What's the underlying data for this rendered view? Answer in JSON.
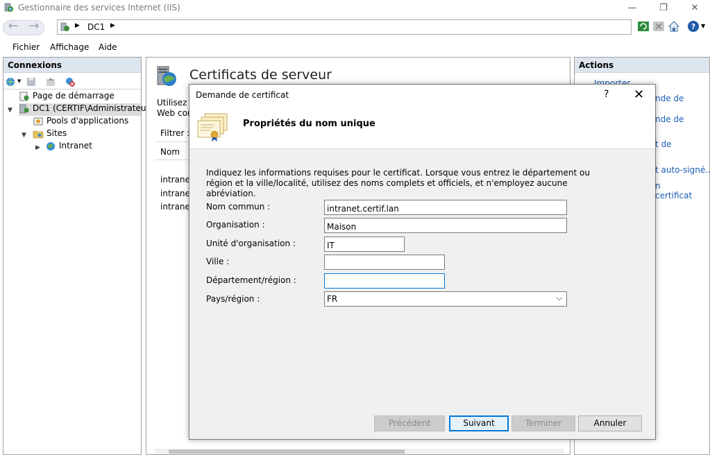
{
  "window": {
    "title": "Gestionnaire des services Internet (IIS)",
    "minimize_glyph": "—",
    "restore_glyph": "❐",
    "close_glyph": "✕"
  },
  "address": {
    "crumb": "DC1",
    "back_glyph": "←",
    "forward_glyph": "→"
  },
  "menu": {
    "file": "Fichier",
    "view": "Affichage",
    "help": "Aide"
  },
  "connections": {
    "header": "Connexions",
    "tree": {
      "start_page": "Page de démarrage",
      "server": "DC1 (CERTIF\\Administrateur)",
      "app_pools": "Pools d'applications",
      "sites": "Sites",
      "intranet": "Intranet"
    }
  },
  "center": {
    "title": "Certificats de serveur",
    "desc_line1": "Utilisez c",
    "desc_line2": "Web con",
    "filter_label": "Filtrer :",
    "column_name": "Nom",
    "rows": [
      "intranet",
      "intranet",
      "intranet."
    ]
  },
  "actions": {
    "header": "Actions",
    "links": [
      "Importer...",
      "nde de",
      "nde de",
      "t de",
      "t auto-signé...",
      "n",
      "certificat"
    ]
  },
  "dialog": {
    "title": "Demande de certificat",
    "help_glyph": "?",
    "close_glyph": "✕",
    "heading": "Propriétés du nom unique",
    "intro": "Indiquez les informations requises pour le certificat. Lorsque vous entrez le département ou région et la ville/localité, utilisez des noms complets et officiels, et n'employez aucune abréviation.",
    "fields": {
      "common_name": {
        "label": "Nom commun :",
        "value": "intranet.certif.lan"
      },
      "organization": {
        "label": "Organisation :",
        "value": "Maison"
      },
      "org_unit": {
        "label": "Unité d'organisation :",
        "value": "IT"
      },
      "city": {
        "label": "Ville :",
        "value": ""
      },
      "state": {
        "label": "Département/région :",
        "value": ""
      },
      "country": {
        "label": "Pays/région :",
        "value": "FR"
      }
    },
    "buttons": {
      "previous": "Précédent",
      "next": "Suivant",
      "finish": "Terminer",
      "cancel": "Annuler"
    }
  }
}
